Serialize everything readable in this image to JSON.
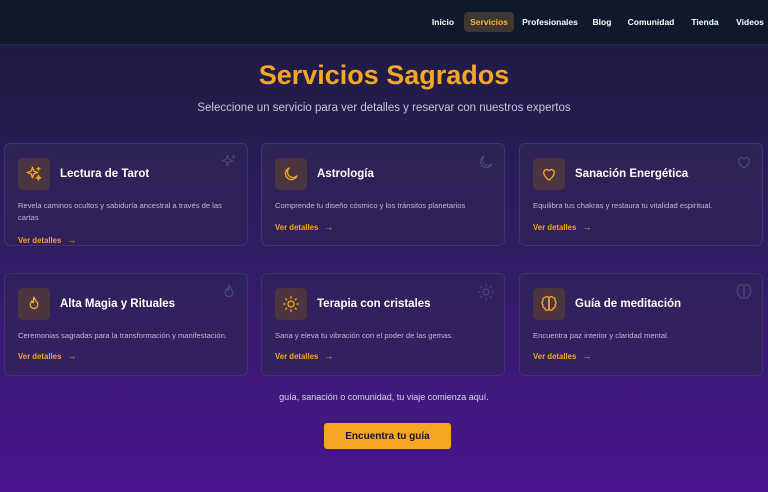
{
  "nav": {
    "items": [
      {
        "label": "Inicio",
        "active": false
      },
      {
        "label": "Servicios",
        "active": true
      },
      {
        "label": "Profesionales",
        "active": false
      },
      {
        "label": "Blog",
        "active": false
      },
      {
        "label": "Comunidad",
        "active": false
      },
      {
        "label": "Tienda",
        "active": false
      },
      {
        "label": "Videos",
        "active": false
      }
    ]
  },
  "hero": {
    "title": "Servicios Sagrados",
    "subtitle": "Seleccione un servicio para ver detalles y reservar con nuestros expertos"
  },
  "cards": [
    {
      "icon": "sparkles-icon",
      "title": "Lectura de Tarot",
      "description": "Revela caminos ocultos y sabiduría ancestral a través de las cartas",
      "link": "Ver detalles"
    },
    {
      "icon": "moon-icon",
      "title": "Astrología",
      "description": "Comprende tu diseño cósmico y los tránsitos planetarios",
      "link": "Ver detalles"
    },
    {
      "icon": "heart-icon",
      "title": "Sanación Energética",
      "description": "Equilibra tus chakras y restaura tu vitalidad espiritual.",
      "link": "Ver detalles"
    },
    {
      "icon": "flame-icon",
      "title": "Alta Magia y Rituales",
      "description": "Ceremonias sagradas para la transformación y manifestación.",
      "link": "Ver detalles"
    },
    {
      "icon": "sun-icon",
      "title": "Terapia con cristales",
      "description": "Sana y eleva tu vibración con el poder de las gemas.",
      "link": "Ver detalles"
    },
    {
      "icon": "brain-icon",
      "title": "Guía de meditación",
      "description": "Encuentra paz interior y claridad mental.",
      "link": "Ver detalles"
    }
  ],
  "overlap_text": "guía, sanación o comunidad, tu viaje comienza aquí.",
  "cta": {
    "label": "Encuentra tu guía"
  },
  "colors": {
    "accent": "#f5a623",
    "nav_bg": "#0e1a2b",
    "card_bg": "#302458"
  }
}
